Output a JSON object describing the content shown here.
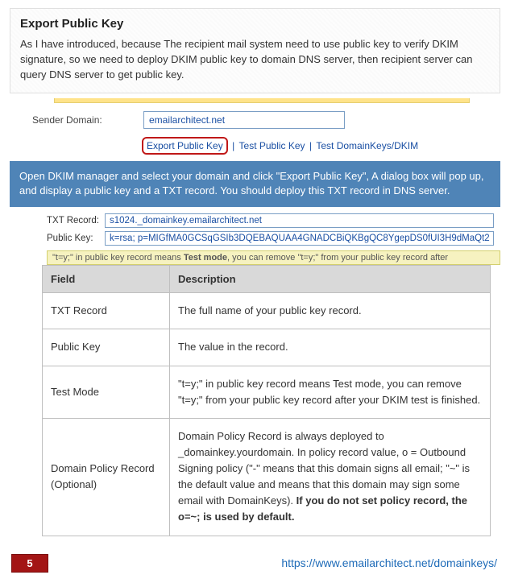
{
  "intro": {
    "heading": "Export Public Key",
    "body": "As I have introduced, because The recipient mail system need to use public key to verify DKIM signature, so we need to deploy DKIM public key to domain DNS server, then recipient server can query DNS server to get public key."
  },
  "form": {
    "sender_domain_label": "Sender Domain:",
    "sender_domain_value": "emailarchitect.net"
  },
  "links": {
    "export": "Export Public Key",
    "test_public": "Test Public Key",
    "test_dkim": "Test DomainKeys/DKIM"
  },
  "callout": "Open DKIM manager and select your domain and click \"Export Public Key\", A dialog box will pop up, and display a public key and a TXT record. You should deploy this TXT record in DNS server.",
  "records": {
    "txt_label": "TXT Record:",
    "txt_value": "s1024._domainkey.emailarchitect.net",
    "pk_label": "Public Key:",
    "pk_value": "k=rsa; p=MIGfMA0GCSqGSIb3DQEBAQUAA4GNADCBiQKBgQC8YgepDS0fUI3H9dMaQt2"
  },
  "note": {
    "prefix": "\"t=y;\" in public key record means ",
    "bold": "Test mode",
    "suffix": ", you can remove \"t=y;\" from your public key record after"
  },
  "table": {
    "header_field": "Field",
    "header_desc": "Description",
    "rows": [
      {
        "field": "TXT Record",
        "desc": "The full name of your public key record."
      },
      {
        "field": "Public Key",
        "desc": "The value in the record."
      },
      {
        "field": "Test Mode",
        "desc": "\"t=y;\" in public key record means Test mode, you can remove \"t=y;\" from your public key record after your DKIM test is finished."
      }
    ],
    "policy": {
      "field": "Domain Policy Record (Optional)",
      "desc_plain": "Domain Policy Record is always deployed to _domainkey.yourdomain. In policy record value, o = Outbound Signing policy (\"-\" means that this domain signs all email; \"~\" is the default value and means that this domain may sign some email with DomainKeys). ",
      "desc_bold": "If you do not set policy record, the o=~; is used by default."
    }
  },
  "footer": {
    "page_number": "5",
    "url": "https://www.emailarchitect.net/domainkeys/"
  }
}
